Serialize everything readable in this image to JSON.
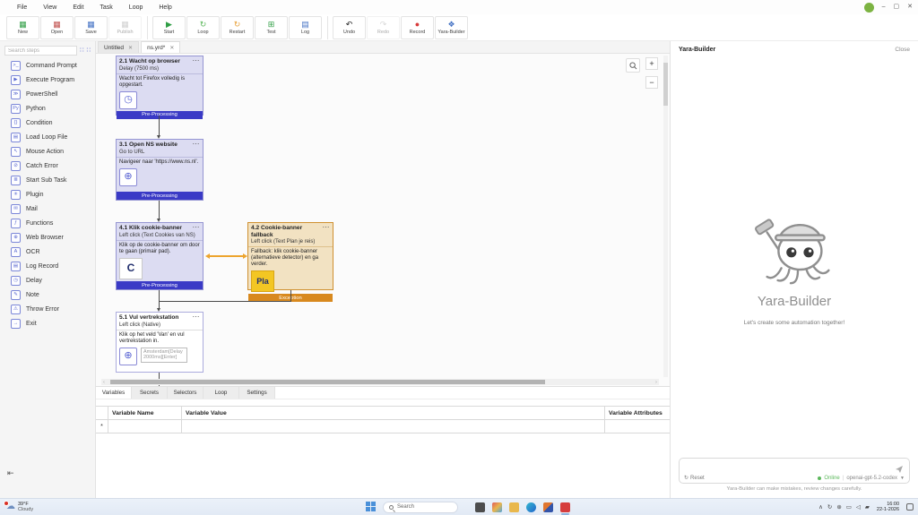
{
  "window": {
    "menu_items": [
      {
        "label": "File"
      },
      {
        "label": "View"
      },
      {
        "label": "Edit"
      },
      {
        "label": "Task"
      },
      {
        "label": "Loop"
      },
      {
        "label": "Help"
      }
    ],
    "controls": {
      "minimize": "–",
      "maximize": "▢",
      "close": "✕"
    }
  },
  "toolbar": {
    "buttons": [
      {
        "label": "New",
        "glyph": "▦"
      },
      {
        "label": "Open",
        "glyph": "▦"
      },
      {
        "label": "Save",
        "glyph": "▦"
      },
      {
        "label": "Publish",
        "glyph": "▦"
      },
      {
        "label": "Start",
        "glyph": "▶"
      },
      {
        "label": "Loop",
        "glyph": "↻"
      },
      {
        "label": "Restart",
        "glyph": "↻"
      },
      {
        "label": "Test",
        "glyph": "⊞"
      },
      {
        "label": "Log",
        "glyph": "▤"
      },
      {
        "label": "Undo",
        "glyph": "↶"
      },
      {
        "label": "Redo",
        "glyph": "↷"
      },
      {
        "label": "Record",
        "glyph": "●"
      },
      {
        "label": "Yara-Builder",
        "glyph": "❖"
      }
    ]
  },
  "sidebar": {
    "search_placeholder": "Search steps",
    "expand_glyph": "∷",
    "collapse_glyph": "∷",
    "collapse_panel_glyph": "⇤",
    "items": [
      {
        "label": "Command Prompt",
        "glyph": ">_"
      },
      {
        "label": "Execute Program",
        "glyph": "▶"
      },
      {
        "label": "PowerShell",
        "glyph": "≫"
      },
      {
        "label": "Python",
        "glyph": "Py"
      },
      {
        "label": "Condition",
        "glyph": "{}"
      },
      {
        "label": "Load Loop File",
        "glyph": "▤"
      },
      {
        "label": "Mouse Action",
        "glyph": "↖"
      },
      {
        "label": "Catch Error",
        "glyph": "⊘"
      },
      {
        "label": "Start Sub Task",
        "glyph": "≣"
      },
      {
        "label": "Plugin",
        "glyph": "✳"
      },
      {
        "label": "Mail",
        "glyph": "✉"
      },
      {
        "label": "Functions",
        "glyph": "ƒ"
      },
      {
        "label": "Web Browser",
        "glyph": "⊕"
      },
      {
        "label": "OCR",
        "glyph": "A"
      },
      {
        "label": "Log Record",
        "glyph": "▤"
      },
      {
        "label": "Delay",
        "glyph": "◷"
      },
      {
        "label": "Note",
        "glyph": "✎"
      },
      {
        "label": "Throw Error",
        "glyph": "⚠"
      },
      {
        "label": "Exit",
        "glyph": "→"
      }
    ]
  },
  "tabs": [
    {
      "label": "Untitled",
      "close": "✕"
    },
    {
      "label": "ns.yrd*",
      "close": "✕"
    }
  ],
  "canvas": {
    "zoom_in": "+",
    "zoom_out": "−",
    "nodes": [
      {
        "title": "2.1 Wacht op browser",
        "menu": "⋯",
        "subtitle": "Delay (7500 ms)",
        "body": "Wacht tot Firefox volledig is opgestart.",
        "icon_glyph": "◷",
        "footer": "Pre-Processing"
      },
      {
        "title": "3.1 Open NS website",
        "menu": "⋯",
        "subtitle": "Go to URL",
        "body": "Navigeer naar 'https://www.ns.nl'.",
        "icon_glyph": "⊕",
        "footer": "Pre-Processing"
      },
      {
        "title": "4.1 Klik cookie-banner",
        "menu": "⋯",
        "subtitle": "Left click (Text Cookies van NS)",
        "body": "Klik op de cookie-banner om door te gaan (primair pad).",
        "thumb": "C",
        "footer": "Pre-Processing"
      },
      {
        "title": "4.2 Cookie-banner fallback",
        "menu": "⋯",
        "subtitle": "Left click (Text Plan je reis)",
        "body": "Fallback: klik cookie-banner (alternatieve detector) en ga verder.",
        "thumb": "Pla",
        "footer": "Exception"
      },
      {
        "title": "5.1 Vul vertrekstation",
        "menu": "⋯",
        "subtitle": "Left click (Native)",
        "body": "Klik op het veld 'Van' en vul vertrekstation in.",
        "icon_glyph": "⊕",
        "input_value": "Amsterdam[Delay 2000ms][Enter]"
      }
    ]
  },
  "bottom_panel": {
    "tabs": [
      {
        "label": "Variables"
      },
      {
        "label": "Secrets"
      },
      {
        "label": "Selectors"
      },
      {
        "label": "Loop"
      },
      {
        "label": "Settings"
      }
    ],
    "table": {
      "columns": [
        "Variable Name",
        "Variable Value",
        "Variable Attributes"
      ],
      "new_row_marker": "*"
    }
  },
  "assistant": {
    "title": "Yara-Builder",
    "close_label": "Close",
    "mascot_name": "Yara-Builder",
    "tagline": "Let's create some automation together!",
    "reset_glyph": "↻",
    "reset_label": "Reset",
    "status_label": "Online",
    "status_color": "#5cb85c",
    "model_label": "openai-gpt-5.2-codex",
    "model_caret": "▼",
    "separator": "|",
    "disclaimer": "Yara-Builder can make mistakes, review changes carefully."
  },
  "taskbar": {
    "weather_temp": "39°F",
    "weather_desc": "Cloudy",
    "weather_icon": "☁",
    "search_placeholder": "Search",
    "app_icons": [
      "files-dark",
      "photos",
      "folder-yellow",
      "edge-browser",
      "media-app",
      "yara-app-active"
    ],
    "tray_icons": [
      {
        "name": "chevron-up-icon",
        "glyph": "∧"
      },
      {
        "name": "sync-icon",
        "glyph": "↻"
      },
      {
        "name": "network-icon",
        "glyph": "⊕"
      },
      {
        "name": "display-icon",
        "glyph": "▭"
      },
      {
        "name": "volume-icon",
        "glyph": "◁"
      },
      {
        "name": "folder-tray-icon",
        "glyph": "▰"
      }
    ],
    "clock_time": "16:00",
    "clock_date": "22-1-2026"
  }
}
